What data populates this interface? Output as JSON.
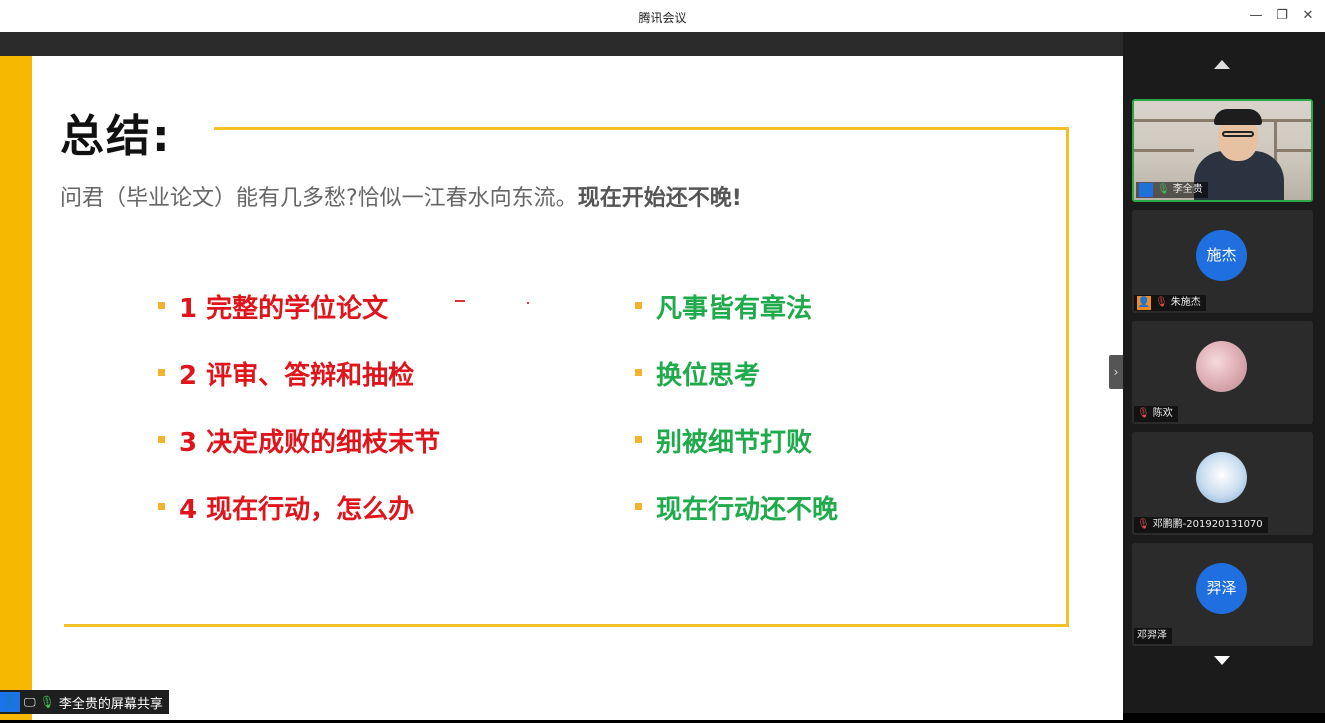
{
  "window": {
    "title": "腾讯会议",
    "minimize_glyph": "—",
    "restore_glyph": "❐",
    "close_glyph": "✕"
  },
  "slide": {
    "heading": "总结:",
    "subtitle_plain": "问君（毕业论文）能有几多愁?恰似一江春水向东流。",
    "subtitle_bold": "现在开始还不晚!",
    "left_points": [
      "1 完整的学位论文",
      "2 评审、答辩和抽检",
      "3 决定成败的细枝末节",
      "4 现在行动，怎么办"
    ],
    "right_points": [
      "凡事皆有章法",
      "换位思考",
      "别被细节打败",
      "现在行动还不晚"
    ],
    "colors": {
      "left_text": "#e0141b",
      "right_text": "#1faa4b",
      "accent": "#f6b800"
    }
  },
  "share": {
    "label": "李全贵的屏幕共享"
  },
  "participants": [
    {
      "name": "李全贵",
      "avatar_text": "",
      "icon": "user-icon",
      "video": true
    },
    {
      "name": "朱施杰",
      "avatar_text": "施杰",
      "icon": "user-icon",
      "video": false
    },
    {
      "name": "陈欢",
      "avatar_text": "",
      "icon": "mic-muted-icon",
      "video": false
    },
    {
      "name": "邓鹏鹏-2019201310​70",
      "avatar_text": "",
      "icon": "mic-muted-icon",
      "video": false
    },
    {
      "name": "邓羿泽",
      "avatar_text": "羿泽",
      "icon": "",
      "video": false
    }
  ]
}
